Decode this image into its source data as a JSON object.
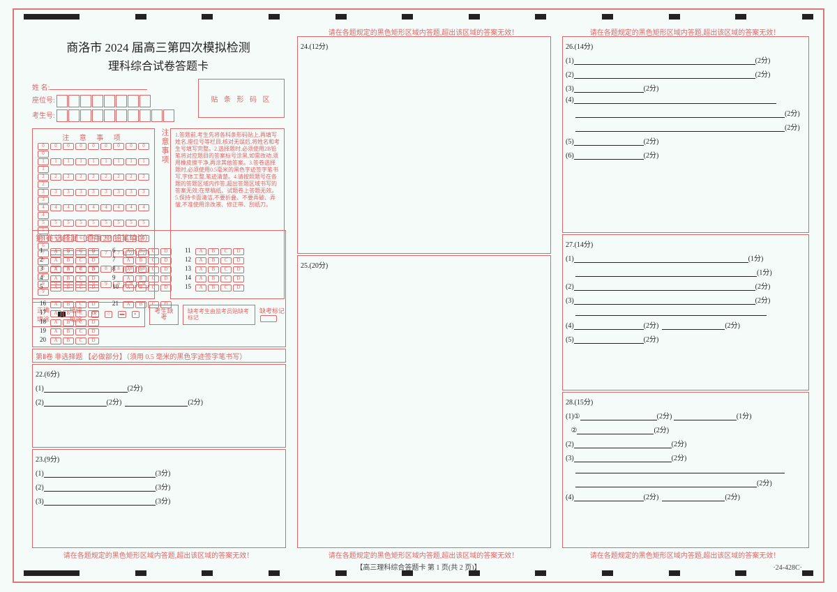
{
  "title1": "商洛市 2024 届高三第四次模拟检测",
  "title2": "理科综合试卷答题卡",
  "fields": {
    "name": "姓 名:",
    "seat": "座位号:",
    "examid": "考生号:"
  },
  "barcode_label": "贴 条 形 码 区",
  "instructions_title": "注 意 事 项",
  "instructions_vert": "注意事项",
  "instructions_body": "1.答题前,考生先将各科条形码贴上,再填写姓名,座位号等栏目,核对无误后,将姓名和考生号填写完整。2.选择题时,必须使用2B铅笔将对应题目的答案标号涂黑,如需改动,须用橡皮擦干净,再涂其他答案。3.答卷选择题时,必须使用0.5毫米的黑色字迹签字笔书写,字体工整,笔迹清楚。4.请按照题号在各题的答题区域内作答,超出答题区域书写的答案无效;在草稿纸、试题卷上答题无效。5.保持卡面清洁,不要折叠、不要弄破、弄皱,不准使用涂改液、修正带、刮纸刀。",
  "fill_example": {
    "correct": "正确填涂",
    "wrong": "错误填涂"
  },
  "absent": {
    "label": "考生缺考",
    "note": "缺考考生由监考员贴缺考标记",
    "mark": "缺考标记"
  },
  "part1": {
    "title": "第Ⅰ卷 选择题（须用 2B 铅笔填涂）",
    "opts": [
      "A",
      "B",
      "C",
      "D"
    ],
    "rows1": [
      1,
      2,
      3,
      4,
      5
    ],
    "rows2": [
      6,
      7,
      8,
      9,
      10
    ],
    "rows3": [
      11,
      12,
      13,
      14,
      15
    ],
    "rows4": [
      16,
      17,
      18,
      19,
      20
    ],
    "rows5": [
      21
    ]
  },
  "part2": {
    "title": "第Ⅱ卷 非选择题 【必做部分】（须用 0.5 毫米的黑色字迹签字笔书写）"
  },
  "warn_top": "请在各题规定的黑色矩形区域内答题,超出该区域的答案无效！",
  "warn_bot": "请在各题规定的黑色矩形区域内答题,超出该区域的答案无效！",
  "q22": {
    "h": "22.(6分)",
    "l1": "(1)",
    "p1": "(2分)",
    "l2": "(2)",
    "p2a": "(2分)",
    "p2b": "(2分)"
  },
  "q23": {
    "h": "23.(9分)",
    "l1": "(1)",
    "l2": "(2)",
    "l3": "(3)",
    "p": "(3分)"
  },
  "q24": {
    "h": "24.(12分)"
  },
  "q25": {
    "h": "25.(20分)"
  },
  "q26": {
    "h": "26.(14分)",
    "p2": "(2分)"
  },
  "q27": {
    "h": "27.(14分)",
    "p1": "(1分)",
    "p2": "(2分)"
  },
  "q28": {
    "h": "28.(15分)",
    "p1": "(1分)",
    "p2": "(2分)"
  },
  "footer": "【高三理科综合答题卡 第 1 页(共 2 页)】",
  "code": "·24-428C·"
}
